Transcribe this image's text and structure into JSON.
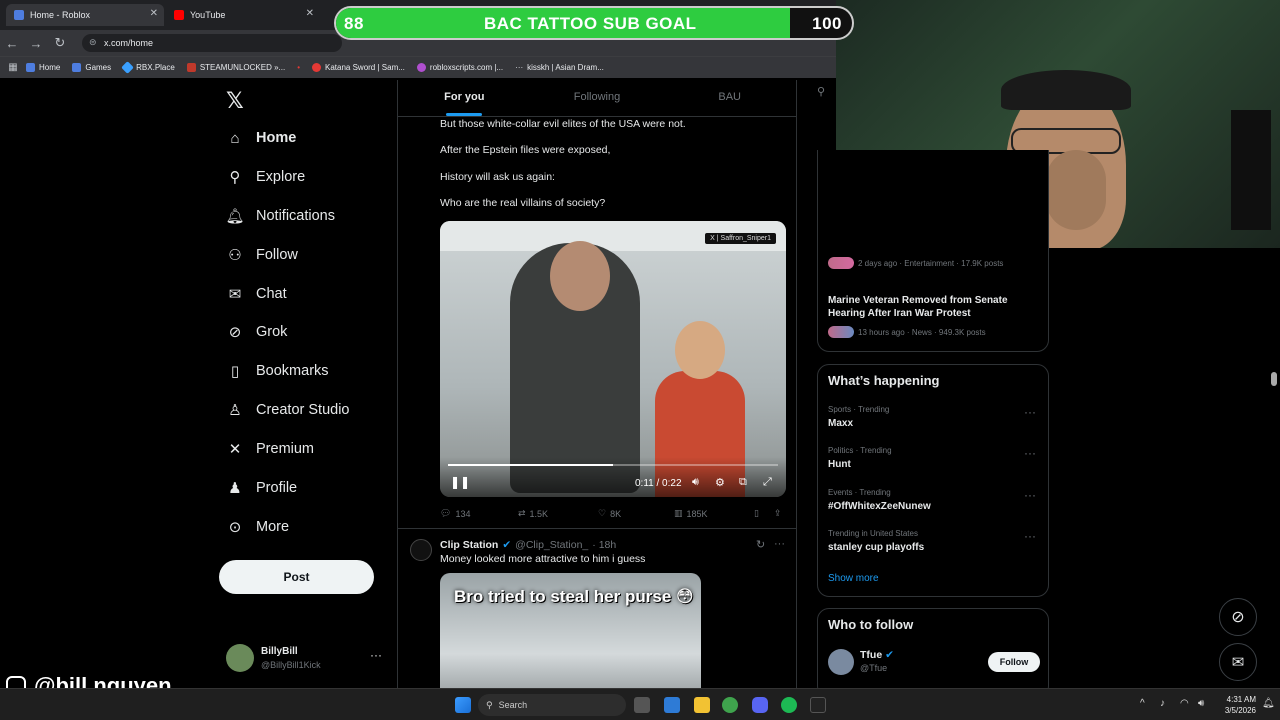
{
  "browser": {
    "tabs": [
      {
        "title": "Home - Roblox",
        "color": "#4e7ddf"
      },
      {
        "title": "YouTube",
        "color": "#ff0000"
      }
    ],
    "url": "x.com/home",
    "bookmarks": [
      "Home",
      "Games",
      "RBX.Place",
      "STEAMUNLOCKED »...",
      "Katana Sword | Sam...",
      "robloxscripts.com |...",
      "kisskh | Asian Dram..."
    ]
  },
  "overlay": {
    "goal_title": "BAC TATTOO SUB GOAL",
    "current": "88",
    "target": "100",
    "progress": 0.88,
    "handle": "@bill.nguyen"
  },
  "sidebar": {
    "items": [
      {
        "label": "Home",
        "icon": "home-icon"
      },
      {
        "label": "Explore",
        "icon": "search-icon"
      },
      {
        "label": "Notifications",
        "icon": "bell-icon"
      },
      {
        "label": "Follow",
        "icon": "add-person-icon"
      },
      {
        "label": "Chat",
        "icon": "mail-icon"
      },
      {
        "label": "Grok",
        "icon": "grok-icon"
      },
      {
        "label": "Bookmarks",
        "icon": "bookmark-icon"
      },
      {
        "label": "Creator Studio",
        "icon": "creator-icon"
      },
      {
        "label": "Premium",
        "icon": "x-icon"
      },
      {
        "label": "Profile",
        "icon": "person-icon"
      },
      {
        "label": "More",
        "icon": "more-icon"
      }
    ],
    "post_label": "Post",
    "account": {
      "name": "BillyBill",
      "handle": "@BillyBill1Kick"
    }
  },
  "feed": {
    "tabs": [
      "For you",
      "Following",
      "BAU"
    ],
    "tweet1": {
      "lines": [
        "But those white-collar evil elites of the USA were not.",
        "After the Epstein files were exposed,",
        "History will ask us again:",
        "Who are the real villains of society?"
      ],
      "video_watermark": "X | Saffron_Sniper1",
      "video_time": "0:11 / 0:22",
      "video_progress": 0.5,
      "replies": "134",
      "reposts": "1.5K",
      "likes": "8K",
      "views": "185K"
    },
    "tweet2": {
      "name": "Clip Station",
      "handle": "@Clip_Station_",
      "time": "· 18h",
      "text": "Money looked more attractive to him i guess",
      "media_caption": "Bro tried to steal her purse 😳"
    }
  },
  "right": {
    "trend_top": [
      {
        "title": "Marine Veteran Removed from Senate Hearing After Iran War Protest",
        "meta": "13 hours ago · News · 949.3K posts"
      }
    ],
    "trend_partial_meta": "2 days ago · Entertainment · 17.9K posts",
    "happening_title": "What’s happening",
    "happening": [
      {
        "meta": "Sports · Trending",
        "name": "Maxx"
      },
      {
        "meta": "Politics · Trending",
        "name": "Hunt"
      },
      {
        "meta": "Events · Trending",
        "name": "#OffWhitexZeeNunew"
      },
      {
        "meta": "Trending in United States",
        "name": "stanley cup playoffs"
      }
    ],
    "show_more": "Show more",
    "wtf_title": "Who to follow",
    "wtf": {
      "name": "Tfue",
      "handle": "@Tfue",
      "button": "Follow"
    }
  },
  "taskbar": {
    "search_placeholder": "Search",
    "time": "4:31 AM",
    "date": "3/5/2026"
  }
}
